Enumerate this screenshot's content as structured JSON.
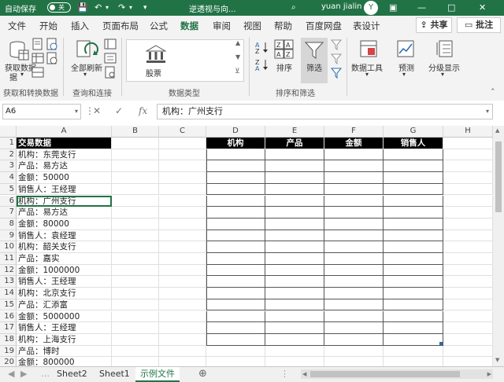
{
  "titlebar": {
    "autosave_label": "自动保存",
    "autosave_state": "关",
    "doc_title": "逆透视与向...",
    "user_name": "yuan jialin",
    "avatar_text": "Y"
  },
  "menu": {
    "tabs": [
      "文件",
      "开始",
      "插入",
      "页面布局",
      "公式",
      "数据",
      "审阅",
      "视图",
      "帮助",
      "百度网盘",
      "表设计"
    ],
    "active_index": 5,
    "share_label": "共享",
    "comment_label": "批注"
  },
  "ribbon": {
    "get_data_label": "获取数据",
    "get_data_label2": "据",
    "refresh_all_label": "全部刷新",
    "stock_label": "股票",
    "sort_label": "排序",
    "filter_label": "筛选",
    "data_tools_label": "数据工具",
    "forecast_label": "预测",
    "outline_label": "分级显示",
    "group_get_transform": "获取和转换数据",
    "group_queries": "查询和连接",
    "group_data_types": "数据类型",
    "group_sort_filter": "排序和筛选"
  },
  "formula_bar": {
    "name_box": "A6",
    "formula": "机构：广州支行"
  },
  "grid": {
    "columns": [
      "A",
      "B",
      "C",
      "D",
      "E",
      "F",
      "G",
      "H"
    ],
    "rows": [
      "1",
      "2",
      "3",
      "4",
      "5",
      "6",
      "7",
      "8",
      "9",
      "10",
      "11",
      "12",
      "13",
      "14",
      "15",
      "16",
      "17",
      "18",
      "19",
      "20"
    ],
    "col_a": [
      "交易数据",
      "机构：东莞支行",
      "产品：易方达",
      "金额：50000",
      "销售人：王经理",
      "机构：广州支行",
      "产品：易方达",
      "金额：80000",
      "销售人：袁经理",
      "机构：韶关支行",
      "产品：嘉实",
      "金额：1000000",
      "销售人：王经理",
      "机构：北京支行",
      "产品：汇添富",
      "金额：5000000",
      "销售人：王经理",
      "机构：上海支行",
      "产品：博时",
      "金额：800000"
    ],
    "table_headers": [
      "机构",
      "产品",
      "金额",
      "销售人"
    ]
  },
  "sheet_tabs": {
    "tabs": [
      "Sheet2",
      "Sheet1",
      "示例文件"
    ],
    "active_index": 2
  }
}
